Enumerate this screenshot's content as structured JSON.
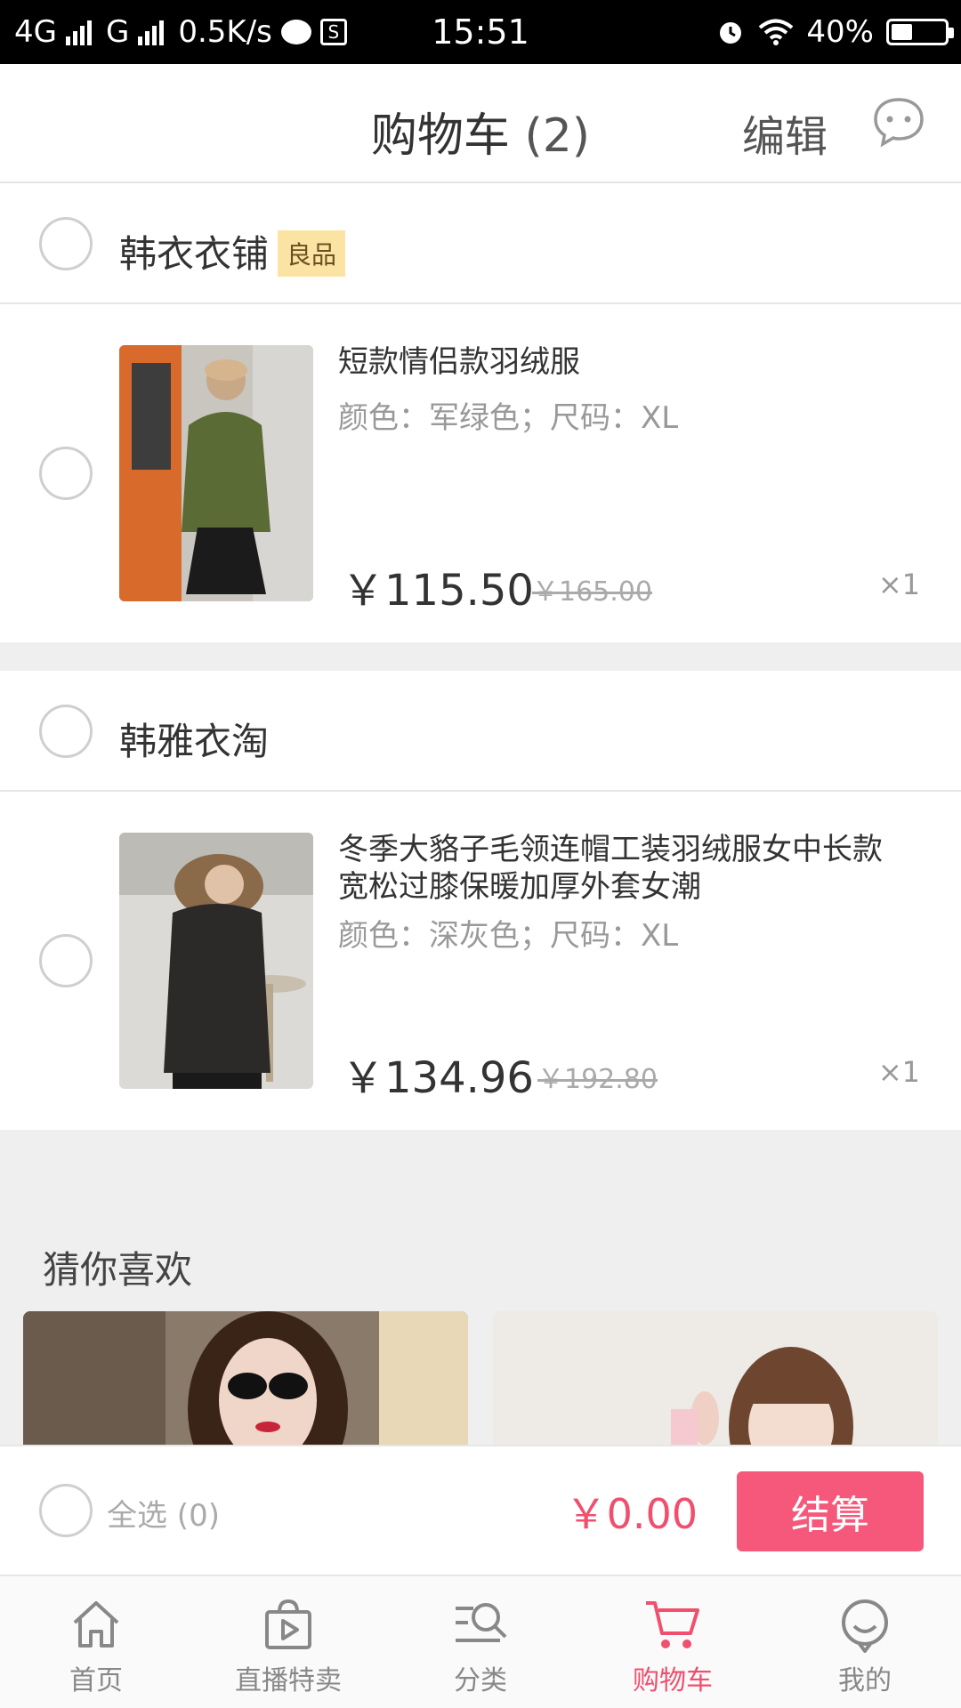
{
  "status_bar": {
    "network_4g": "4G",
    "network_g": "G",
    "speed": "0.5K/s",
    "sim_icon": "S",
    "time": "15:51",
    "battery": "40%",
    "battery_level": 0.4
  },
  "header": {
    "title": "购物车",
    "count": "(2)",
    "edit_label": "编辑",
    "message_icon": "chat-bubble-icon"
  },
  "shops": [
    {
      "name": "韩衣衣铺",
      "badge": "良品",
      "items": [
        {
          "title": "短款情侣款羽绒服",
          "spec": "颜色：军绿色；尺码：XL",
          "price": "￥115.50",
          "old_price": "￥165.00",
          "qty": "×1"
        }
      ]
    },
    {
      "name": "韩雅衣淘",
      "items": [
        {
          "title": "冬季大貉子毛领连帽工装羽绒服女中长款宽松过膝保暖加厚外套女潮",
          "spec": "颜色：深灰色；尺码：XL",
          "price": "￥134.96",
          "old_price": "￥192.80",
          "qty": "×1"
        }
      ]
    }
  ],
  "recommend": {
    "title": "猜你喜欢"
  },
  "checkout": {
    "select_all": "全选 (0)",
    "total": "￥0.00",
    "button": "结算"
  },
  "tabs": [
    {
      "label": "首页",
      "icon": "home-icon"
    },
    {
      "label": "直播特卖",
      "icon": "live-bag-icon"
    },
    {
      "label": "分类",
      "icon": "category-search-icon"
    },
    {
      "label": "购物车",
      "icon": "cart-icon",
      "active": true
    },
    {
      "label": "我的",
      "icon": "profile-icon"
    }
  ],
  "colors": {
    "accent": "#f0506e",
    "button": "#f5587a",
    "badge_bg": "#fbe3a4",
    "gap_gray": "#efefef"
  }
}
